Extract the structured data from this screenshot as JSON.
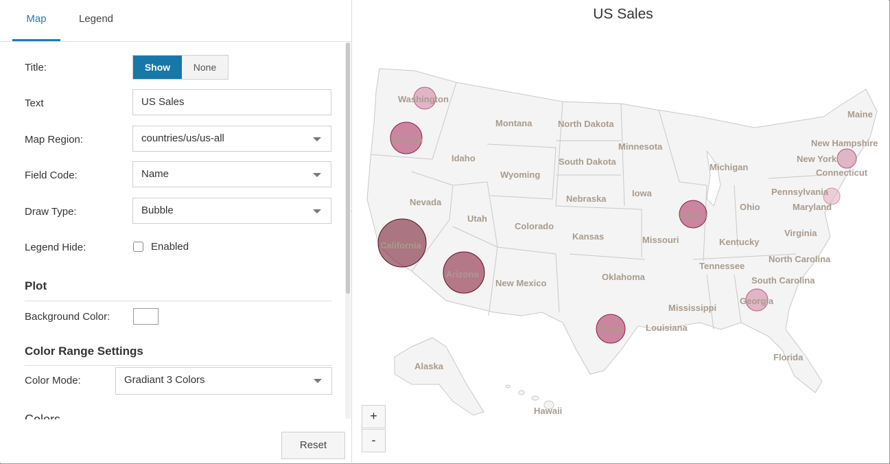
{
  "tabs": {
    "map": "Map",
    "legend": "Legend"
  },
  "form": {
    "title_label": "Title:",
    "title_toggle": {
      "on": "Show",
      "off": "None",
      "selected": "Show"
    },
    "text_label": "Text",
    "text_value": "US Sales",
    "map_region_label": "Map Region:",
    "map_region_value": "countries/us/us-all",
    "field_code_label": "Field Code:",
    "field_code_value": "Name",
    "draw_type_label": "Draw Type:",
    "draw_type_value": "Bubble",
    "legend_hide_label": "Legend Hide:",
    "legend_hide_checkbox": "Enabled",
    "legend_hide_checked": false
  },
  "plot": {
    "section": "Plot",
    "background_color_label": "Background Color:",
    "background_color": "#ffffff"
  },
  "color_range": {
    "section": "Color Range Settings",
    "color_mode_label": "Color Mode:",
    "color_mode_value": "Gradiant 3 Colors",
    "colors_section": "Colors"
  },
  "reset_label": "Reset",
  "map": {
    "title": "US Sales",
    "zoom_in": "+",
    "zoom_out": "-",
    "state_labels": [
      "Washington",
      "Oregon",
      "California",
      "Nevada",
      "Idaho",
      "Montana",
      "Wyoming",
      "Utah",
      "Arizona",
      "Colorado",
      "New Mexico",
      "North Dakota",
      "South Dakota",
      "Nebraska",
      "Kansas",
      "Oklahoma",
      "Texas",
      "Minnesota",
      "Iowa",
      "Missouri",
      "Louisiana",
      "Mississippi",
      "Illinois",
      "Michigan",
      "Ohio",
      "Kentucky",
      "Tennessee",
      "Virginia",
      "North Carolina",
      "South Carolina",
      "Georgia",
      "Florida",
      "Pennsylvania",
      "Maryland",
      "New York",
      "Connecticut",
      "New Hampshire",
      "Maine",
      "Alaska",
      "Hawaii"
    ],
    "colors": {
      "land": "#f4f4f4",
      "border": "#c8c8c8",
      "bubble_fill": "#b03a68",
      "bubble_dark": "#7a1f33",
      "label": "#a99b8d"
    }
  }
}
